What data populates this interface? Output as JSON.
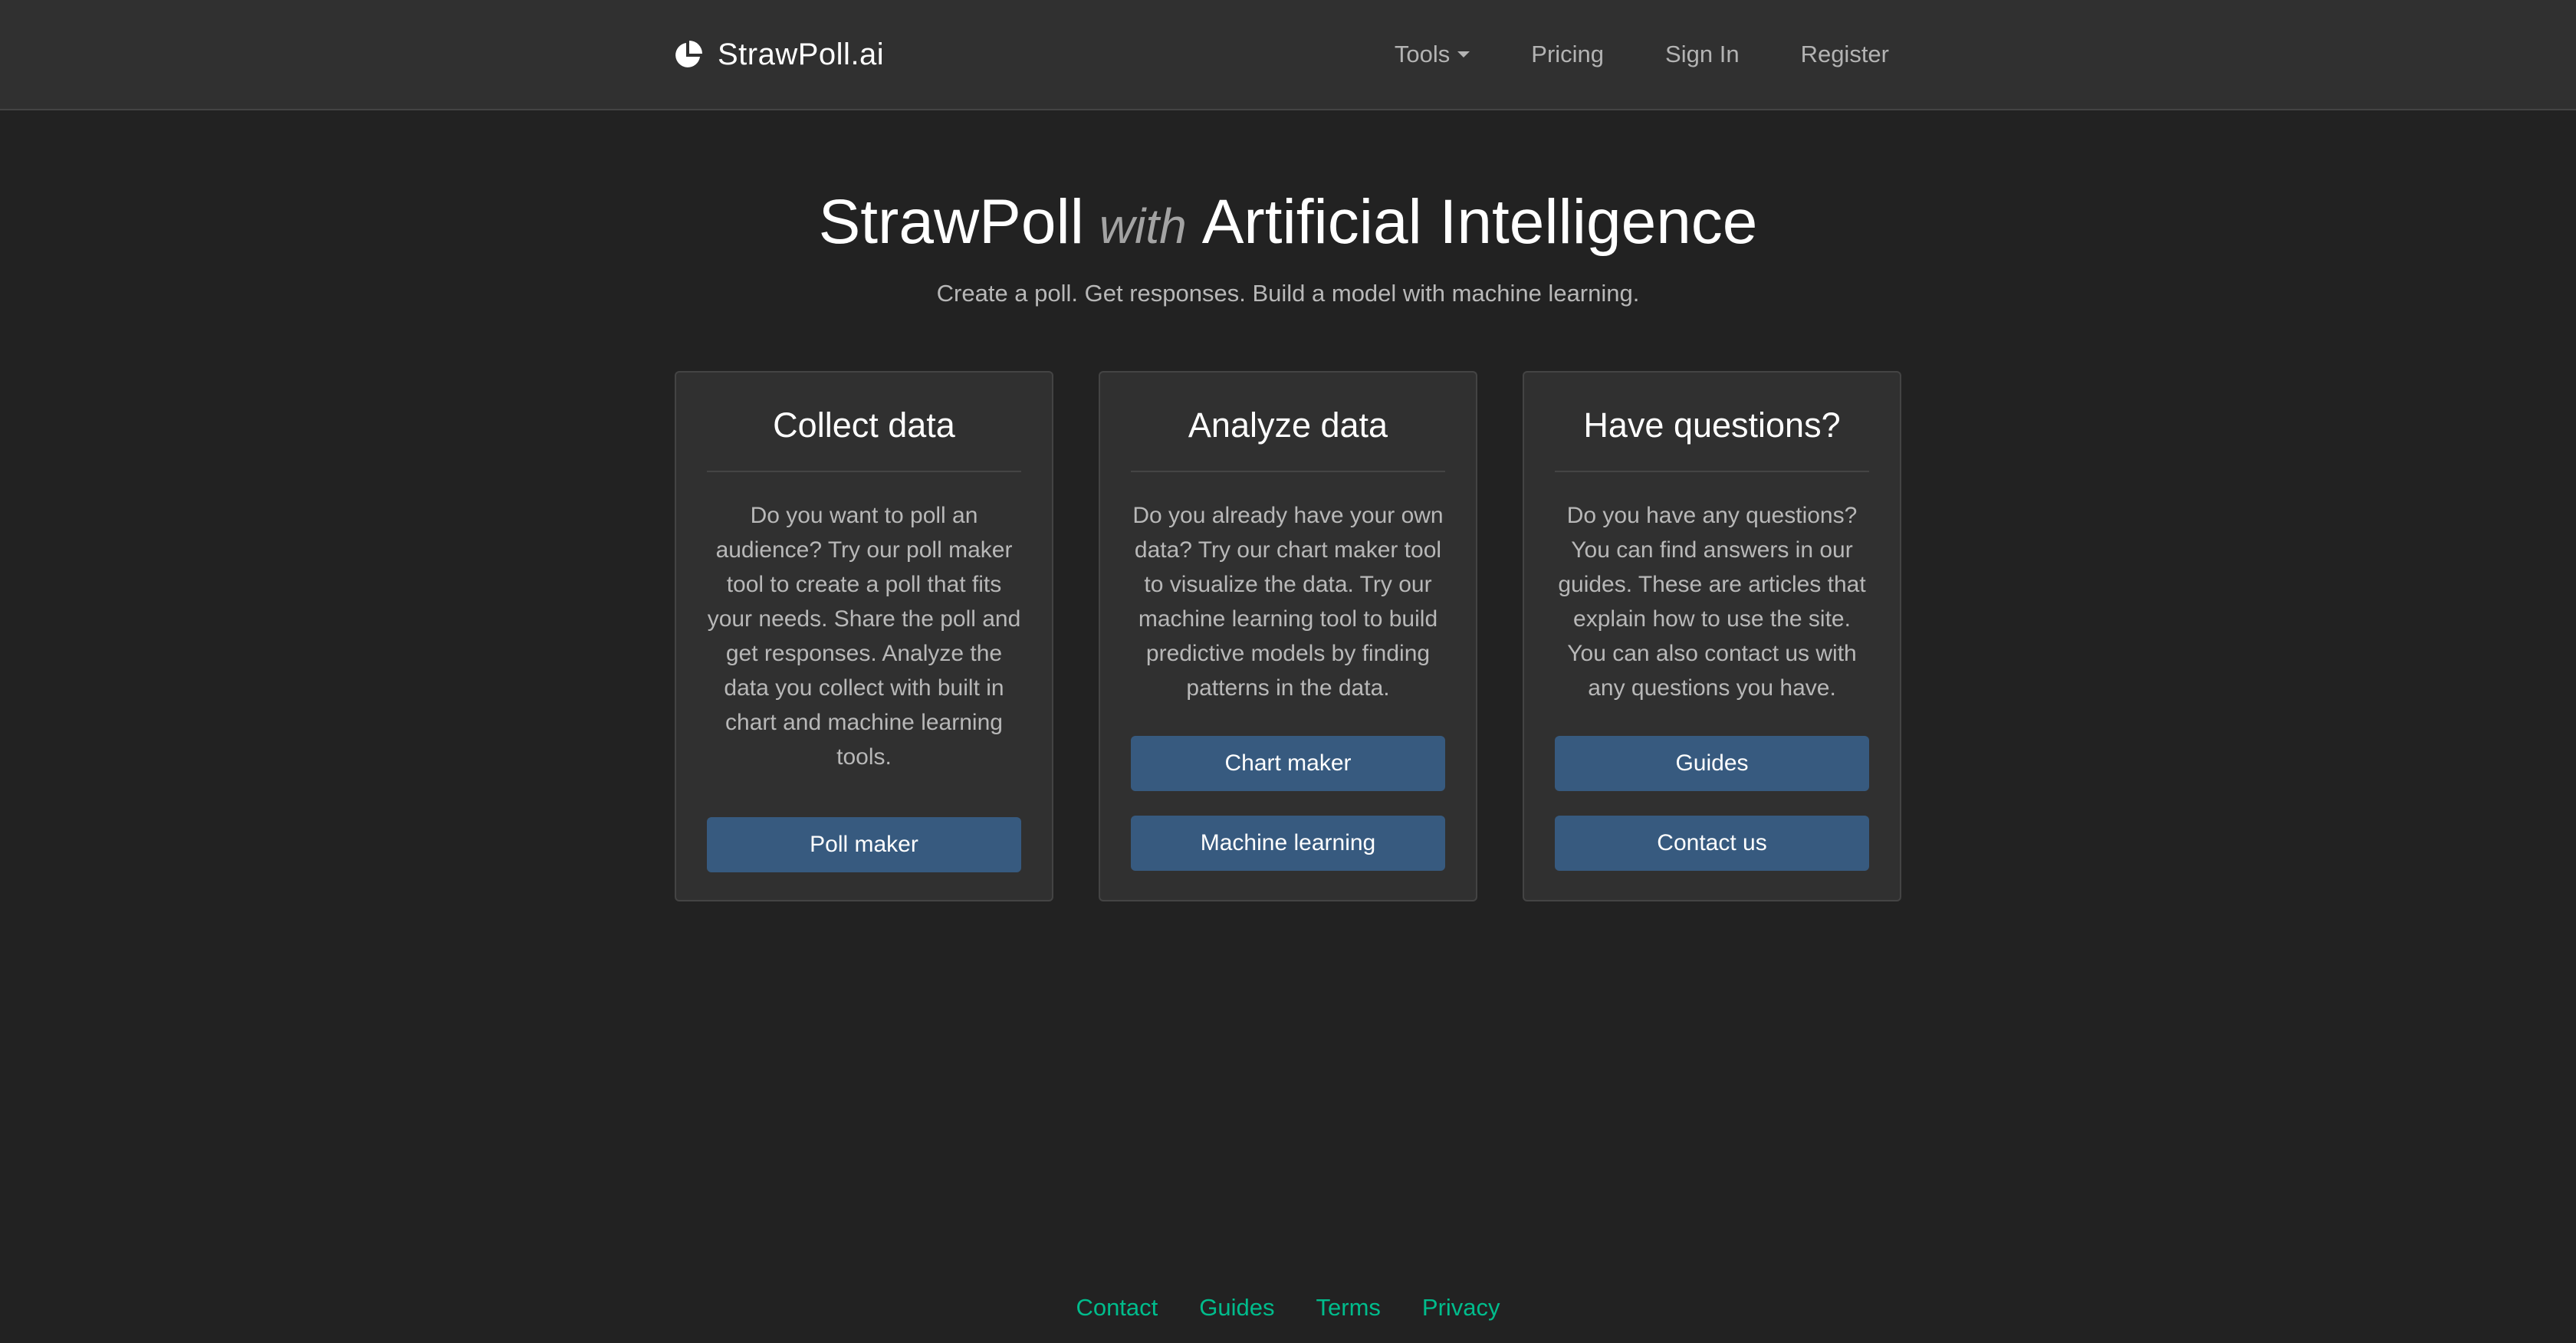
{
  "navbar": {
    "brand": "StrawPoll.ai",
    "brand_icon": "pie-chart-icon",
    "links": {
      "tools": "Tools",
      "pricing": "Pricing",
      "sign_in": "Sign In",
      "register": "Register"
    }
  },
  "hero": {
    "title_part1": "StrawPoll",
    "title_with": "with",
    "title_part2": "Artificial Intelligence",
    "subtitle": "Create a poll. Get responses. Build a model with machine learning."
  },
  "cards": [
    {
      "title": "Collect data",
      "text": "Do you want to poll an audience? Try our poll maker tool to create a poll that fits your needs. Share the poll and get responses. Analyze the data you collect with built in chart and machine learning tools.",
      "buttons": [
        "Poll maker"
      ]
    },
    {
      "title": "Analyze data",
      "text": "Do you already have your own data? Try our chart maker tool to visualize the data. Try our machine learning tool to build predictive models by finding patterns in the data.",
      "buttons": [
        "Chart maker",
        "Machine learning"
      ]
    },
    {
      "title": "Have questions?",
      "text": "Do you have any questions? You can find answers in our guides. These are articles that explain how to use the site. You can also contact us with any questions you have.",
      "buttons": [
        "Guides",
        "Contact us"
      ]
    }
  ],
  "footer": {
    "links": [
      "Contact",
      "Guides",
      "Terms",
      "Privacy"
    ]
  },
  "colors": {
    "background": "#222222",
    "navbar": "#303030",
    "card": "#303030",
    "button": "#375a7f",
    "footer_link": "#00bc8c"
  }
}
